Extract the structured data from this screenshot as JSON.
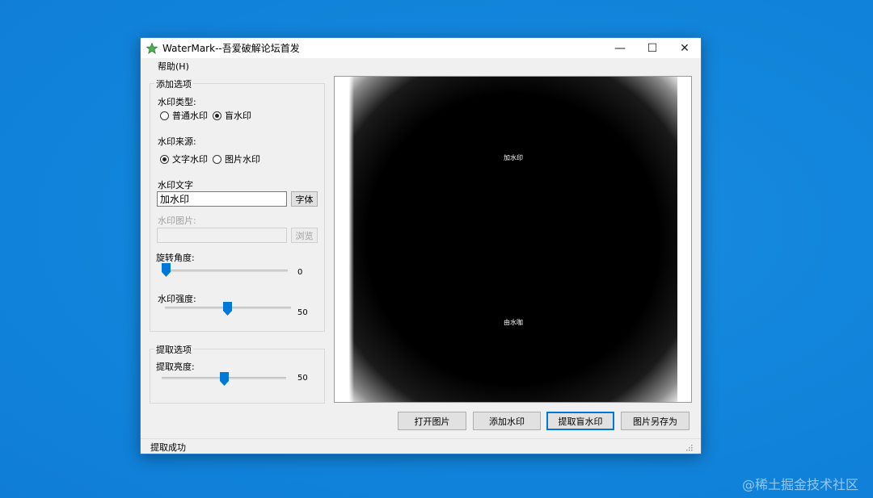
{
  "window": {
    "title": "WaterMark--吾爱破解论坛首发",
    "minimize": "—",
    "maximize": "☐",
    "close": "✕"
  },
  "menu": {
    "help": "帮助(H)"
  },
  "add_options": {
    "group_title": "添加选项",
    "type_label": "水印类型:",
    "type_options": [
      "普通水印",
      "盲水印"
    ],
    "type_selected": "盲水印",
    "source_label": "水印来源:",
    "source_options": [
      "文字水印",
      "图片水印"
    ],
    "source_selected": "文字水印",
    "text_label": "水印文字",
    "text_value": "加水印",
    "font_button": "字体",
    "image_label": "水印图片:",
    "image_value": "",
    "browse_button": "浏览",
    "rotation_label": "旋转角度:",
    "rotation_value": "0",
    "strength_label": "水印强度:",
    "strength_value": "50"
  },
  "extract_options": {
    "group_title": "提取选项",
    "brightness_label": "提取亮度:",
    "brightness_value": "50"
  },
  "preview": {
    "text_top": "加水印",
    "text_bottom": "由水咖"
  },
  "buttons": {
    "open": "打开图片",
    "add": "添加水印",
    "extract": "提取盲水印",
    "save_as": "图片另存为"
  },
  "status": {
    "text": "提取成功"
  },
  "desktop_watermark": "@稀土掘金技术社区",
  "colors": {
    "accent": "#0078d7",
    "desktop": "#1286dc"
  }
}
